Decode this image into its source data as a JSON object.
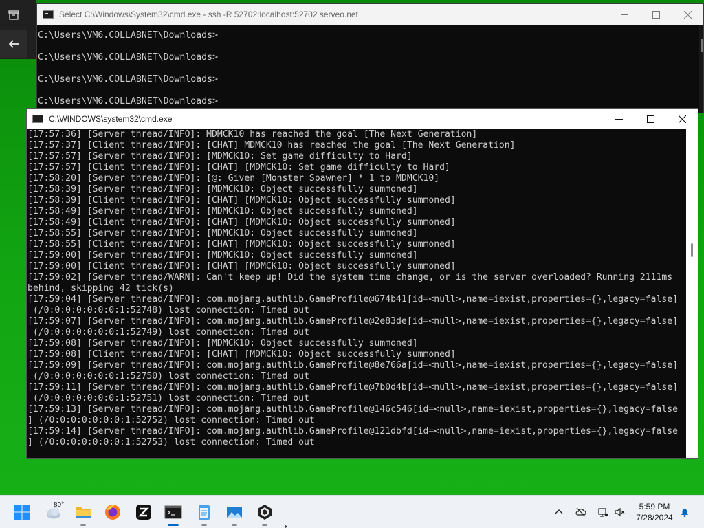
{
  "back_window": {
    "title": "Select C:\\Windows\\System32\\cmd.exe - ssh  -R 52702:localhost:52702 serveo.net",
    "lines": [
      "C:\\Users\\VM6.COLLABNET\\Downloads>",
      "C:\\Users\\VM6.COLLABNET\\Downloads>",
      "C:\\Users\\VM6.COLLABNET\\Downloads>",
      "C:\\Users\\VM6.COLLABNET\\Downloads>"
    ]
  },
  "front_window": {
    "title": "C:\\WINDOWS\\system32\\cmd.exe",
    "lines": [
      "[17:57:36] [Server thread/INFO]: MDMCK10 has reached the goal [The Next Generation]",
      "[17:57:37] [Client thread/INFO]: [CHAT] MDMCK10 has reached the goal [The Next Generation]",
      "[17:57:57] [Server thread/INFO]: [MDMCK10: Set game difficulty to Hard]",
      "[17:57:57] [Client thread/INFO]: [CHAT] [MDMCK10: Set game difficulty to Hard]",
      "[17:58:20] [Server thread/INFO]: [@: Given [Monster Spawner] * 1 to MDMCK10]",
      "[17:58:39] [Server thread/INFO]: [MDMCK10: Object successfully summoned]",
      "[17:58:39] [Client thread/INFO]: [CHAT] [MDMCK10: Object successfully summoned]",
      "[17:58:49] [Server thread/INFO]: [MDMCK10: Object successfully summoned]",
      "[17:58:49] [Client thread/INFO]: [CHAT] [MDMCK10: Object successfully summoned]",
      "[17:58:55] [Server thread/INFO]: [MDMCK10: Object successfully summoned]",
      "[17:58:55] [Client thread/INFO]: [CHAT] [MDMCK10: Object successfully summoned]",
      "[17:59:00] [Server thread/INFO]: [MDMCK10: Object successfully summoned]",
      "[17:59:00] [Client thread/INFO]: [CHAT] [MDMCK10: Object successfully summoned]",
      "[17:59:02] [Server thread/WARN]: Can't keep up! Did the system time change, or is the server overloaded? Running 2111ms",
      "behind, skipping 42 tick(s)",
      "[17:59:04] [Server thread/INFO]: com.mojang.authlib.GameProfile@674b41[id=<null>,name=iexist,properties={},legacy=false]",
      " (/0:0:0:0:0:0:0:1:52748) lost connection: Timed out",
      "[17:59:07] [Server thread/INFO]: com.mojang.authlib.GameProfile@2e83de[id=<null>,name=iexist,properties={},legacy=false]",
      " (/0:0:0:0:0:0:0:1:52749) lost connection: Timed out",
      "[17:59:08] [Server thread/INFO]: [MDMCK10: Object successfully summoned]",
      "[17:59:08] [Client thread/INFO]: [CHAT] [MDMCK10: Object successfully summoned]",
      "[17:59:09] [Server thread/INFO]: com.mojang.authlib.GameProfile@8e766a[id=<null>,name=iexist,properties={},legacy=false]",
      " (/0:0:0:0:0:0:0:1:52750) lost connection: Timed out",
      "[17:59:11] [Server thread/INFO]: com.mojang.authlib.GameProfile@7b0d4b[id=<null>,name=iexist,properties={},legacy=false]",
      " (/0:0:0:0:0:0:0:1:52751) lost connection: Timed out",
      "[17:59:13] [Server thread/INFO]: com.mojang.authlib.GameProfile@146c546[id=<null>,name=iexist,properties={},legacy=false",
      "] (/0:0:0:0:0:0:0:1:52752) lost connection: Timed out",
      "[17:59:14] [Server thread/INFO]: com.mojang.authlib.GameProfile@121dbfd[id=<null>,name=iexist,properties={},legacy=false",
      "] (/0:0:0:0:0:0:0:1:52753) lost connection: Timed out"
    ]
  },
  "taskbar": {
    "weather_temp": "80°",
    "clock_time": "5:59 PM",
    "clock_date": "7/28/2024",
    "pinned": [
      {
        "name": "start-button",
        "icon": "windows-logo-icon"
      },
      {
        "name": "weather-widget",
        "icon": "cloud-icon"
      },
      {
        "name": "file-explorer",
        "icon": "folder-icon"
      },
      {
        "name": "firefox",
        "icon": "firefox-icon"
      },
      {
        "name": "zed-app",
        "icon": "zed-icon"
      },
      {
        "name": "terminal",
        "icon": "terminal-icon"
      },
      {
        "name": "notepad",
        "icon": "notepad-icon"
      },
      {
        "name": "photos",
        "icon": "photos-icon"
      },
      {
        "name": "minecraft",
        "icon": "minecraft-icon"
      }
    ]
  },
  "colors": {
    "desktop": "#12a512",
    "console_bg": "#0c0c0c",
    "console_fg": "#cccccc",
    "accent": "#0067c0"
  }
}
